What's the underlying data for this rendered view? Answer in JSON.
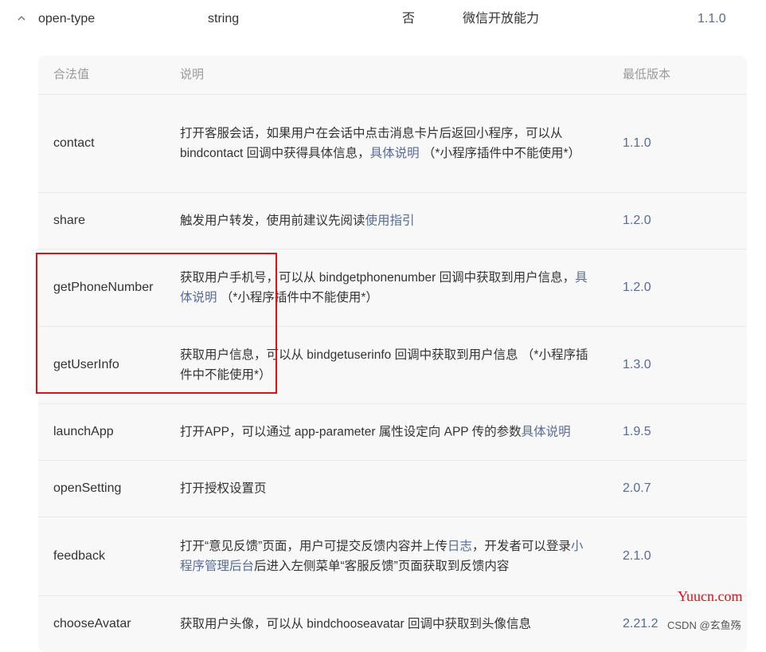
{
  "attribute_row": {
    "name": "open-type",
    "type": "string",
    "required": "否",
    "description": "微信开放能力",
    "min_version": "1.1.0",
    "expand_icon": "chevron-up-icon"
  },
  "value_table": {
    "headers": {
      "value": "合法值",
      "description": "说明",
      "min_version": "最低版本"
    },
    "rows": [
      {
        "value": "contact",
        "desc": [
          {
            "text": "打开客服会话，如果用户在会话中点击消息卡片后返回小程序，可以从 bindcontact 回调中获得具体信息，"
          },
          {
            "text": "具体说明",
            "link": true
          },
          {
            "text": " （*小程序插件中不能使用*）"
          }
        ],
        "version": "1.1.0"
      },
      {
        "value": "share",
        "desc": [
          {
            "text": "触发用户转发，使用前建议先阅读"
          },
          {
            "text": "使用指引",
            "link": true
          }
        ],
        "version": "1.2.0"
      },
      {
        "value": "getPhoneNumber",
        "desc": [
          {
            "text": "获取用户手机号，可以从 bindgetphonenumber 回调中获取到用户信息，"
          },
          {
            "text": "具体说明",
            "link": true
          },
          {
            "text": " （*小程序插件中不能使用*）"
          }
        ],
        "version": "1.2.0"
      },
      {
        "value": "getUserInfo",
        "desc": [
          {
            "text": "获取用户信息，可以从 bindgetuserinfo 回调中获取到用户信息 （*小程序插件中不能使用*）"
          }
        ],
        "version": "1.3.0"
      },
      {
        "value": "launchApp",
        "desc": [
          {
            "text": "打开APP，可以通过 app-parameter 属性设定向 APP 传的参数"
          },
          {
            "text": "具体说明",
            "link": true
          }
        ],
        "version": "1.9.5"
      },
      {
        "value": "openSetting",
        "desc": [
          {
            "text": "打开授权设置页"
          }
        ],
        "version": "2.0.7"
      },
      {
        "value": "feedback",
        "desc": [
          {
            "text": "打开“意见反馈”页面，用户可提交反馈内容并上传"
          },
          {
            "text": "日志",
            "link": true
          },
          {
            "text": "，开发者可以登录"
          },
          {
            "text": "小程序管理后台",
            "link": true
          },
          {
            "text": "后进入左侧菜单“客服反馈”页面获取到反馈内容"
          }
        ],
        "version": "2.1.0"
      },
      {
        "value": "chooseAvatar",
        "desc": [
          {
            "text": "获取用户头像，可以从 bindchooseavatar 回调中获取到头像信息"
          }
        ],
        "version": "2.21.2"
      }
    ]
  },
  "watermarks": {
    "site": "Yuucn.com",
    "author": "CSDN @玄鱼殇"
  },
  "colors": {
    "link": "#576b95",
    "highlight_border": "#e0101b",
    "table_background": "#f8f8f8",
    "header_text": "#9a9a9a"
  }
}
